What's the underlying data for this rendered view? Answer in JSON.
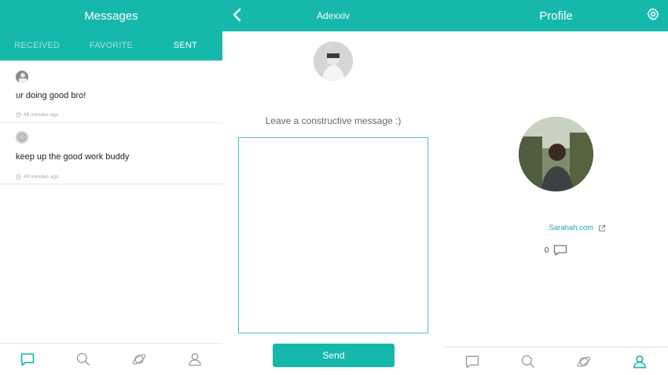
{
  "messages_panel": {
    "title": "Messages",
    "tabs": [
      {
        "label": "RECEIVED",
        "active": false
      },
      {
        "label": "FAVORITE",
        "active": false
      },
      {
        "label": "SENT",
        "active": true
      }
    ],
    "items": [
      {
        "text": "ur doing good bro!",
        "time": "48 minutes ago"
      },
      {
        "text": "keep up the good work buddy",
        "time": "49 minutes ago"
      }
    ]
  },
  "compose_panel": {
    "title": "Adexxiv",
    "prompt": "Leave a constructive message :)",
    "message_value": "",
    "send_label": "Send"
  },
  "profile_panel": {
    "title": "Profile",
    "site": ".Sarahah.com",
    "message_count": "0"
  },
  "bottom_nav": [
    {
      "icon": "chat-bubble-icon"
    },
    {
      "icon": "search-icon"
    },
    {
      "icon": "planet-icon"
    },
    {
      "icon": "user-icon"
    }
  ],
  "colors": {
    "accent": "#17b8ac",
    "accent_light": "#9de5dd",
    "link": "#17a3b7"
  }
}
